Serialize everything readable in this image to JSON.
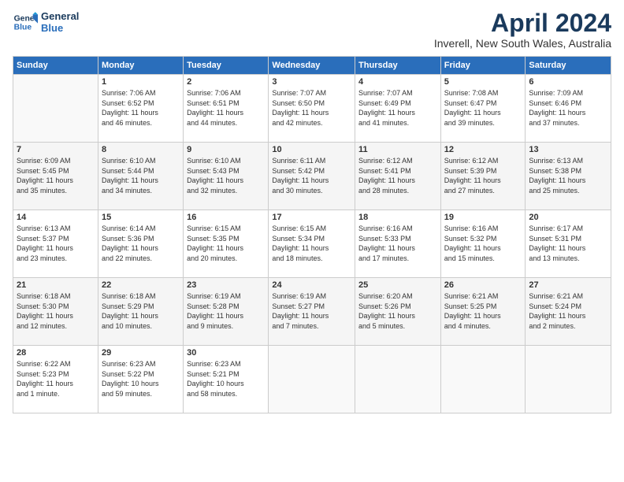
{
  "header": {
    "logo_line1": "General",
    "logo_line2": "Blue",
    "title": "April 2024",
    "subtitle": "Inverell, New South Wales, Australia"
  },
  "calendar": {
    "days_of_week": [
      "Sunday",
      "Monday",
      "Tuesday",
      "Wednesday",
      "Thursday",
      "Friday",
      "Saturday"
    ],
    "weeks": [
      [
        {
          "day": "",
          "info": ""
        },
        {
          "day": "1",
          "info": "Sunrise: 7:06 AM\nSunset: 6:52 PM\nDaylight: 11 hours\nand 46 minutes."
        },
        {
          "day": "2",
          "info": "Sunrise: 7:06 AM\nSunset: 6:51 PM\nDaylight: 11 hours\nand 44 minutes."
        },
        {
          "day": "3",
          "info": "Sunrise: 7:07 AM\nSunset: 6:50 PM\nDaylight: 11 hours\nand 42 minutes."
        },
        {
          "day": "4",
          "info": "Sunrise: 7:07 AM\nSunset: 6:49 PM\nDaylight: 11 hours\nand 41 minutes."
        },
        {
          "day": "5",
          "info": "Sunrise: 7:08 AM\nSunset: 6:47 PM\nDaylight: 11 hours\nand 39 minutes."
        },
        {
          "day": "6",
          "info": "Sunrise: 7:09 AM\nSunset: 6:46 PM\nDaylight: 11 hours\nand 37 minutes."
        }
      ],
      [
        {
          "day": "7",
          "info": "Sunrise: 6:09 AM\nSunset: 5:45 PM\nDaylight: 11 hours\nand 35 minutes."
        },
        {
          "day": "8",
          "info": "Sunrise: 6:10 AM\nSunset: 5:44 PM\nDaylight: 11 hours\nand 34 minutes."
        },
        {
          "day": "9",
          "info": "Sunrise: 6:10 AM\nSunset: 5:43 PM\nDaylight: 11 hours\nand 32 minutes."
        },
        {
          "day": "10",
          "info": "Sunrise: 6:11 AM\nSunset: 5:42 PM\nDaylight: 11 hours\nand 30 minutes."
        },
        {
          "day": "11",
          "info": "Sunrise: 6:12 AM\nSunset: 5:41 PM\nDaylight: 11 hours\nand 28 minutes."
        },
        {
          "day": "12",
          "info": "Sunrise: 6:12 AM\nSunset: 5:39 PM\nDaylight: 11 hours\nand 27 minutes."
        },
        {
          "day": "13",
          "info": "Sunrise: 6:13 AM\nSunset: 5:38 PM\nDaylight: 11 hours\nand 25 minutes."
        }
      ],
      [
        {
          "day": "14",
          "info": "Sunrise: 6:13 AM\nSunset: 5:37 PM\nDaylight: 11 hours\nand 23 minutes."
        },
        {
          "day": "15",
          "info": "Sunrise: 6:14 AM\nSunset: 5:36 PM\nDaylight: 11 hours\nand 22 minutes."
        },
        {
          "day": "16",
          "info": "Sunrise: 6:15 AM\nSunset: 5:35 PM\nDaylight: 11 hours\nand 20 minutes."
        },
        {
          "day": "17",
          "info": "Sunrise: 6:15 AM\nSunset: 5:34 PM\nDaylight: 11 hours\nand 18 minutes."
        },
        {
          "day": "18",
          "info": "Sunrise: 6:16 AM\nSunset: 5:33 PM\nDaylight: 11 hours\nand 17 minutes."
        },
        {
          "day": "19",
          "info": "Sunrise: 6:16 AM\nSunset: 5:32 PM\nDaylight: 11 hours\nand 15 minutes."
        },
        {
          "day": "20",
          "info": "Sunrise: 6:17 AM\nSunset: 5:31 PM\nDaylight: 11 hours\nand 13 minutes."
        }
      ],
      [
        {
          "day": "21",
          "info": "Sunrise: 6:18 AM\nSunset: 5:30 PM\nDaylight: 11 hours\nand 12 minutes."
        },
        {
          "day": "22",
          "info": "Sunrise: 6:18 AM\nSunset: 5:29 PM\nDaylight: 11 hours\nand 10 minutes."
        },
        {
          "day": "23",
          "info": "Sunrise: 6:19 AM\nSunset: 5:28 PM\nDaylight: 11 hours\nand 9 minutes."
        },
        {
          "day": "24",
          "info": "Sunrise: 6:19 AM\nSunset: 5:27 PM\nDaylight: 11 hours\nand 7 minutes."
        },
        {
          "day": "25",
          "info": "Sunrise: 6:20 AM\nSunset: 5:26 PM\nDaylight: 11 hours\nand 5 minutes."
        },
        {
          "day": "26",
          "info": "Sunrise: 6:21 AM\nSunset: 5:25 PM\nDaylight: 11 hours\nand 4 minutes."
        },
        {
          "day": "27",
          "info": "Sunrise: 6:21 AM\nSunset: 5:24 PM\nDaylight: 11 hours\nand 2 minutes."
        }
      ],
      [
        {
          "day": "28",
          "info": "Sunrise: 6:22 AM\nSunset: 5:23 PM\nDaylight: 11 hours\nand 1 minute."
        },
        {
          "day": "29",
          "info": "Sunrise: 6:23 AM\nSunset: 5:22 PM\nDaylight: 10 hours\nand 59 minutes."
        },
        {
          "day": "30",
          "info": "Sunrise: 6:23 AM\nSunset: 5:21 PM\nDaylight: 10 hours\nand 58 minutes."
        },
        {
          "day": "",
          "info": ""
        },
        {
          "day": "",
          "info": ""
        },
        {
          "day": "",
          "info": ""
        },
        {
          "day": "",
          "info": ""
        }
      ]
    ]
  }
}
